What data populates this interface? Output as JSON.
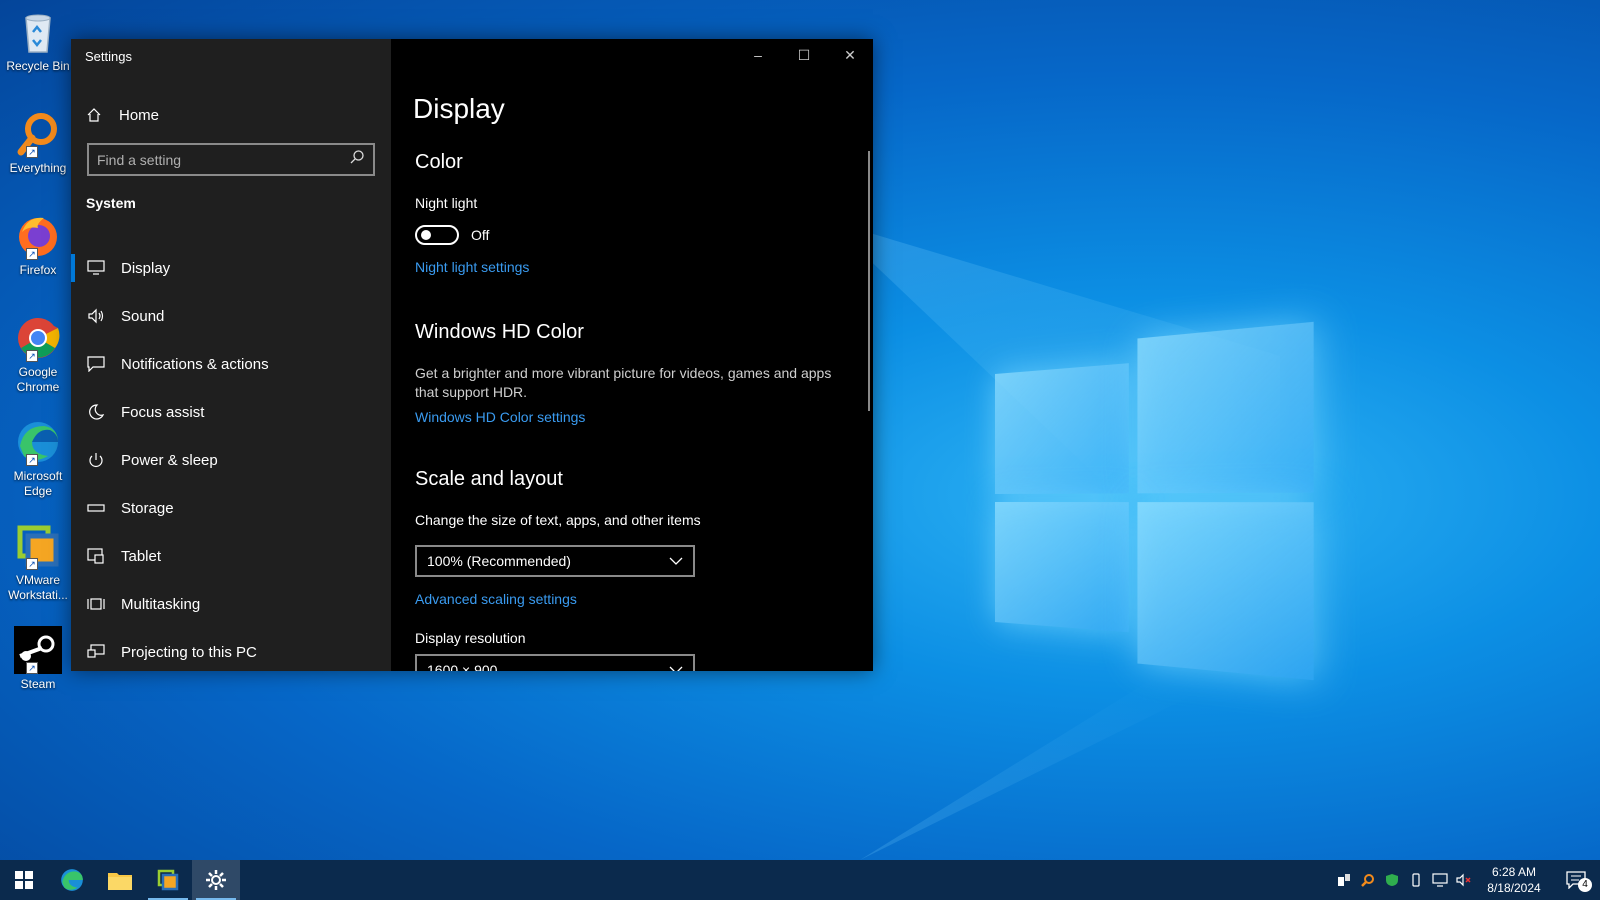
{
  "desktop": {
    "icons": [
      {
        "label": "Recycle Bin"
      },
      {
        "label": "Everything"
      },
      {
        "label": "Firefox"
      },
      {
        "label": "Google Chrome"
      },
      {
        "label": "Microsoft Edge"
      },
      {
        "label": "VMware Workstati..."
      },
      {
        "label": "Steam"
      }
    ]
  },
  "window": {
    "title": "Settings",
    "caption": {
      "minimize": "–",
      "maximize": "☐",
      "close": "✕"
    }
  },
  "sidebar": {
    "home": "Home",
    "search_placeholder": "Find a setting",
    "section": "System",
    "items": [
      {
        "label": "Display",
        "icon": "monitor-icon"
      },
      {
        "label": "Sound",
        "icon": "speaker-icon"
      },
      {
        "label": "Notifications & actions",
        "icon": "message-icon"
      },
      {
        "label": "Focus assist",
        "icon": "moon-icon"
      },
      {
        "label": "Power & sleep",
        "icon": "power-icon"
      },
      {
        "label": "Storage",
        "icon": "storage-icon"
      },
      {
        "label": "Tablet",
        "icon": "tablet-icon"
      },
      {
        "label": "Multitasking",
        "icon": "multitasking-icon"
      },
      {
        "label": "Projecting to this PC",
        "icon": "projecting-icon"
      }
    ]
  },
  "content": {
    "title": "Display",
    "color": {
      "heading": "Color",
      "night_light_label": "Night light",
      "night_light_state": "Off",
      "night_light_link": "Night light settings"
    },
    "hdr": {
      "heading": "Windows HD Color",
      "description": "Get a brighter and more vibrant picture for videos, games and apps that support HDR.",
      "link": "Windows HD Color settings"
    },
    "scale": {
      "heading": "Scale and layout",
      "size_label": "Change the size of text, apps, and other items",
      "size_value": "100% (Recommended)",
      "advanced_link": "Advanced scaling settings",
      "resolution_label": "Display resolution",
      "resolution_value": "1600 × 900"
    }
  },
  "taskbar": {
    "time": "6:28 AM",
    "date": "8/18/2024",
    "notification_count": "4"
  }
}
